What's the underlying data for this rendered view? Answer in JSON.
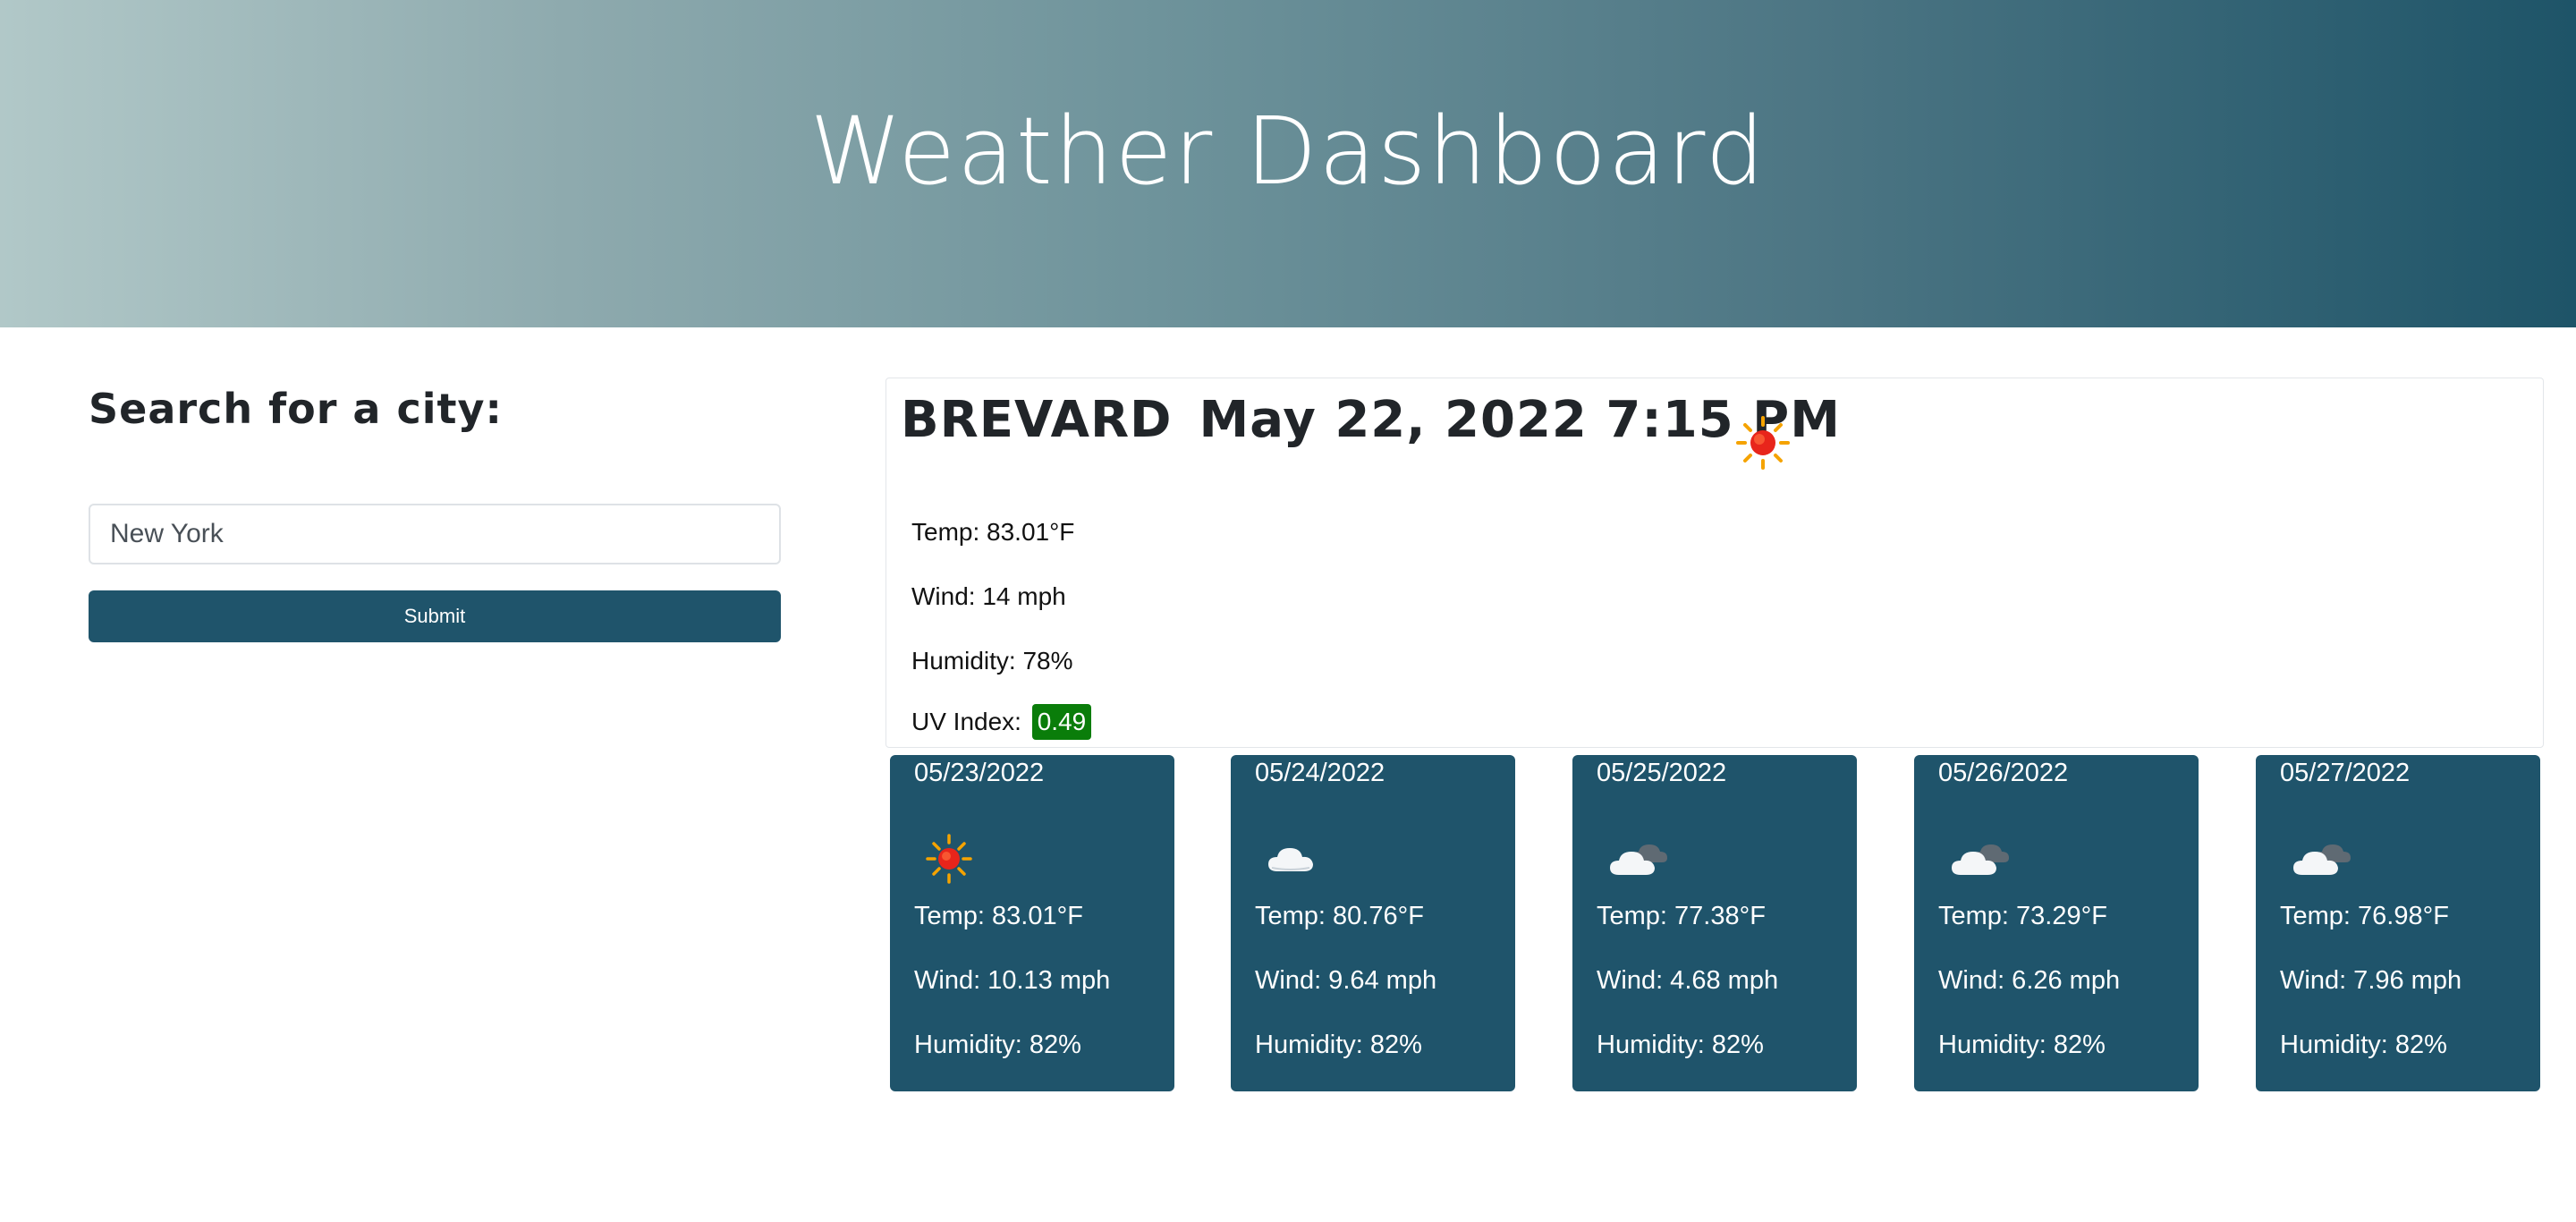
{
  "header": {
    "title": "Weather Dashboard"
  },
  "search": {
    "title": "Search for a city:",
    "input_value": "New York",
    "placeholder": "",
    "submit_label": "Submit"
  },
  "current": {
    "city": "BREVARD",
    "datetime": "May 22, 2022 7:15 PM",
    "icon": "sun-icon",
    "temp": "Temp: 83.01°F",
    "wind": "Wind: 14 mph",
    "humidity": "Humidity: 78%",
    "uv_label": "UV Index:",
    "uv_value": "0.49",
    "uv_color": "#0a7d0a"
  },
  "forecast": [
    {
      "date": "05/23/2022",
      "icon": "sun-icon",
      "temp": "Temp: 83.01°F",
      "wind": "Wind: 10.13 mph",
      "humidity": "Humidity: 82%"
    },
    {
      "date": "05/24/2022",
      "icon": "cloud-icon",
      "temp": "Temp: 80.76°F",
      "wind": "Wind: 9.64 mph",
      "humidity": "Humidity: 82%"
    },
    {
      "date": "05/25/2022",
      "icon": "broken-clouds-icon",
      "temp": "Temp: 77.38°F",
      "wind": "Wind: 4.68 mph",
      "humidity": "Humidity: 82%"
    },
    {
      "date": "05/26/2022",
      "icon": "broken-clouds-icon",
      "temp": "Temp: 73.29°F",
      "wind": "Wind: 6.26 mph",
      "humidity": "Humidity: 82%"
    },
    {
      "date": "05/27/2022",
      "icon": "broken-clouds-icon",
      "temp": "Temp: 76.98°F",
      "wind": "Wind: 7.96 mph",
      "humidity": "Humidity: 82%"
    }
  ],
  "colors": {
    "accent": "#1f546b",
    "header_gradient_start": "#b1c8c8",
    "header_gradient_end": "#1e5468"
  }
}
